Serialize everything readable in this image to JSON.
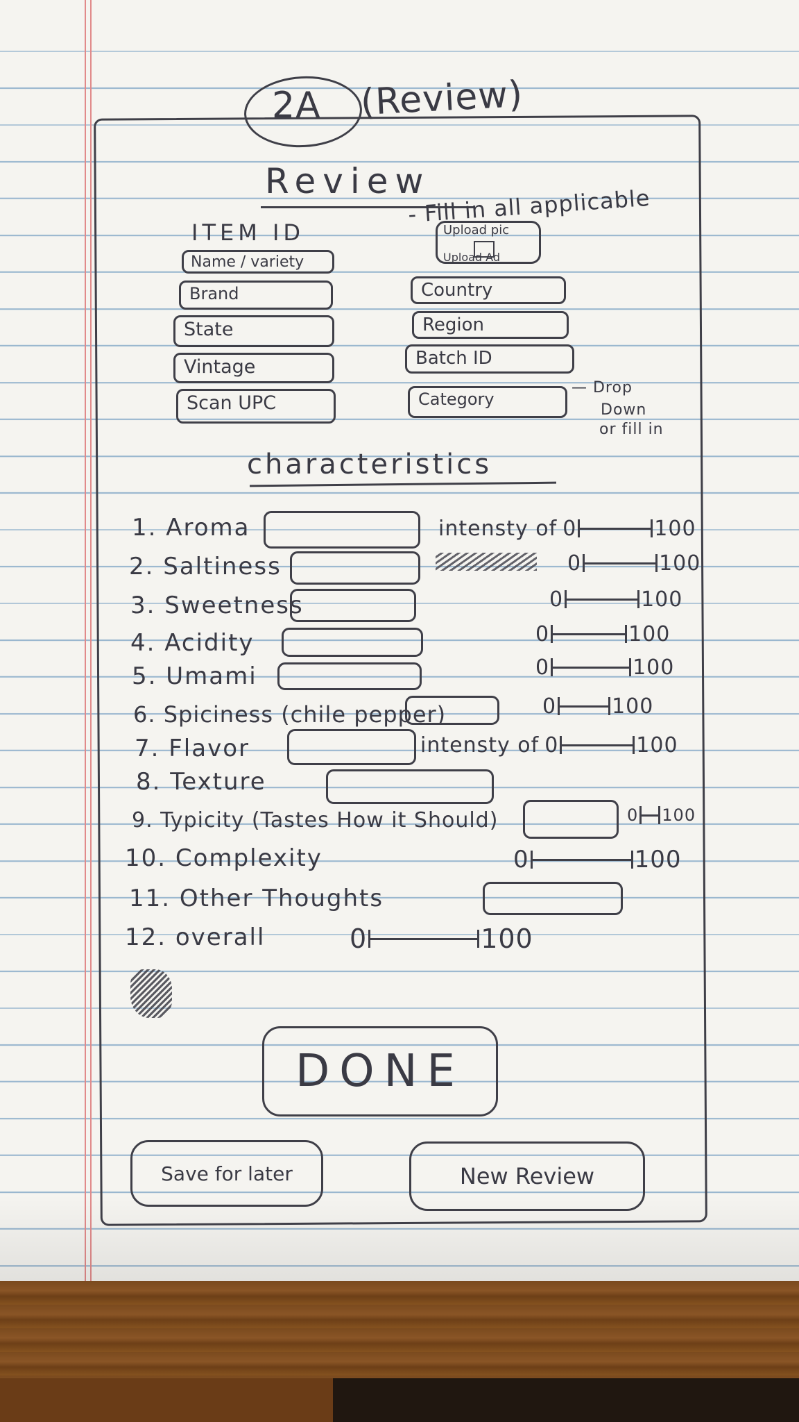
{
  "header": {
    "screen_id": "2A",
    "screen_name": "(Review)"
  },
  "form": {
    "title": "Review",
    "item_id_label": "ITEM ID",
    "instruction": "- Fill in all applicable",
    "upload": {
      "label": "Upload pic",
      "sub_label": "Upload Ad"
    },
    "left_fields": [
      "Name / variety",
      "Brand",
      "State",
      "Vintage",
      "Scan UPC"
    ],
    "right_fields": [
      "Country",
      "Region",
      "Batch ID",
      "Category"
    ],
    "category_note": [
      "— Drop",
      "Down",
      "or fill in"
    ],
    "section_title": "characteristics"
  },
  "characteristics": [
    {
      "label": "1. Aroma",
      "scale": {
        "prefix": "intensty of",
        "min": "0",
        "max": "100"
      }
    },
    {
      "label": "2. Saltiness",
      "scale": {
        "prefix": "",
        "min": "0",
        "max": "100"
      }
    },
    {
      "label": "3. Sweetness",
      "scale": {
        "prefix": "",
        "min": "0",
        "max": "100"
      }
    },
    {
      "label": "4. Acidity",
      "scale": {
        "prefix": "",
        "min": "0",
        "max": "100"
      }
    },
    {
      "label": "5. Umami",
      "scale": {
        "prefix": "",
        "min": "0",
        "max": "100"
      }
    },
    {
      "label": "6. Spiciness (chile pepper)",
      "scale": {
        "prefix": "",
        "min": "0",
        "max": "100"
      }
    },
    {
      "label": "7. Flavor",
      "scale": {
        "prefix": "intensty of",
        "min": "0",
        "max": "100"
      }
    },
    {
      "label": "8. Texture"
    },
    {
      "label": "9. Typicity (Tastes How it Should)",
      "scale": {
        "prefix": "",
        "min": "0",
        "max": "100"
      }
    },
    {
      "label": "10. Complexity",
      "scale": {
        "prefix": "",
        "min": "0",
        "max": "100"
      }
    },
    {
      "label": "11. Other Thoughts"
    },
    {
      "label": "12. overall",
      "scale": {
        "prefix": "",
        "min": "0",
        "max": "100"
      }
    }
  ],
  "buttons": {
    "done": "DONE",
    "save_for_later": "Save for later",
    "new_review": "New Review"
  }
}
